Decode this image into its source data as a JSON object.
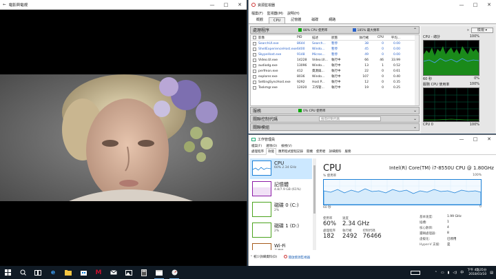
{
  "movie": {
    "title": "電影與電視",
    "controls": {
      "minimize": "—",
      "maximize": "□",
      "close": "✕",
      "back": "←"
    }
  },
  "resmon": {
    "title": "資源監視器",
    "menu": [
      "檔案(F)",
      "監視器(M)",
      "說明(H)"
    ],
    "tabs": [
      "概觀",
      "CPU",
      "記憶體",
      "磁碟",
      "網路"
    ],
    "active_tab": "CPU",
    "processes": {
      "label": "處理程序",
      "usage": "88% CPU 使用率",
      "freq": "185% 最大頻率",
      "columns": [
        "影像",
        "PID",
        "描述",
        "狀態",
        "執行緒",
        "CPU",
        "平均..."
      ],
      "rows": [
        {
          "img": "SearchUI.exe",
          "pid": "8644",
          "desc": "Search...",
          "state": "暫停",
          "th": "38",
          "cpu": "0",
          "avg": "0.00",
          "blue": true
        },
        {
          "img": "ShellExperienceHost.exe",
          "pid": "6400",
          "desc": "Windo...",
          "state": "暫停",
          "th": "45",
          "cpu": "0",
          "avg": "0.00",
          "blue": true
        },
        {
          "img": "SkypeHost.exe",
          "pid": "9148",
          "desc": "Micros...",
          "state": "暫停",
          "th": "49",
          "cpu": "0",
          "avg": "0.00",
          "blue": true
        },
        {
          "img": "Video.UI.exe",
          "pid": "14228",
          "desc": "Video.UI...",
          "state": "執行中",
          "th": "66",
          "cpu": "46",
          "avg": "33.99",
          "blue": false
        },
        {
          "img": "audiodg.exe",
          "pid": "13096",
          "desc": "Windo...",
          "state": "執行中",
          "th": "13",
          "cpu": "1",
          "avg": "0.52",
          "blue": false
        },
        {
          "img": "perfmon.exe",
          "pid": "412",
          "desc": "資源與...",
          "state": "執行中",
          "th": "22",
          "cpu": "0",
          "avg": "0.61",
          "blue": false
        },
        {
          "img": "explorer.exe",
          "pid": "8036",
          "desc": "Windo...",
          "state": "執行中",
          "th": "107",
          "cpu": "0",
          "avg": "0.40",
          "blue": false
        },
        {
          "img": "SettingSyncHost.exe",
          "pid": "9292",
          "desc": "Host P...",
          "state": "執行中",
          "th": "12",
          "cpu": "0",
          "avg": "0.35",
          "blue": false
        },
        {
          "img": "Taskmgr.exe",
          "pid": "12020",
          "desc": "工作管...",
          "state": "執行中",
          "th": "19",
          "cpu": "0",
          "avg": "0.25",
          "blue": false
        }
      ]
    },
    "services": {
      "label": "服務",
      "usage": "0% CPU 使用率"
    },
    "handles": {
      "label": "關聯控制代碼",
      "search_placeholder": "搜尋控制代碼"
    },
    "modules": {
      "label": "關聯模組"
    },
    "right": {
      "view_label": "檢視",
      "graph1_title": "CPU - 總計",
      "graph1_value": "100%",
      "graph1_footer_left": "60 秒",
      "graph1_footer_right": "0%",
      "graph2_title": "服務 CPU 使用率",
      "graph2_value": "100%",
      "graph2_footer_left": "CPU 0",
      "graph2_footer_right": "100%"
    }
  },
  "taskmgr": {
    "title": "工作管理員",
    "menu": [
      "檔案(F)",
      "選項(O)",
      "檢視(V)"
    ],
    "tabs": [
      "處理程序",
      "效能",
      "應用程式歷程記錄",
      "開機",
      "使用者",
      "詳細資料",
      "服務"
    ],
    "active_tab": "效能",
    "side_items": [
      {
        "name": "CPU",
        "sub": "60% 2.34 GHz",
        "color": "#1a7fd6"
      },
      {
        "name": "記憶體",
        "sub": "4.8/7.9 GB (61%)",
        "color": "#8b1aa6"
      },
      {
        "name": "磁碟 0 (C:)",
        "sub": "2%",
        "color": "#4aa31c"
      },
      {
        "name": "磁碟 1 (D:)",
        "sub": "2%",
        "color": "#4aa31c"
      },
      {
        "name": "Wi-Fi",
        "sub": "未連線",
        "color": "#a55a1a"
      }
    ],
    "main": {
      "title": "CPU",
      "model": "Intel(R) Core(TM) i7-8550U CPU @ 1.80GHz",
      "graph_label_left": "% 使用率",
      "graph_label_right": "100%",
      "graph_footer_left": "60 秒",
      "graph_footer_right": "0",
      "stats": [
        {
          "k": "使用率",
          "v": "60%"
        },
        {
          "k": "速度",
          "v": "2.34 GHz"
        }
      ],
      "stats2": [
        {
          "k": "處理程序",
          "v": "182"
        },
        {
          "k": "執行緒",
          "v": "2492"
        },
        {
          "k": "控制代碼",
          "v": "76466"
        }
      ],
      "info": [
        [
          "基本速度:",
          "1.99 GHz"
        ],
        [
          "插槽:",
          "1"
        ],
        [
          "核心數目:",
          "4"
        ],
        [
          "邏輯處理器:",
          "8"
        ],
        [
          "虛擬化:",
          "已停用"
        ],
        [
          "Hyper-V 支援:",
          "是"
        ]
      ]
    },
    "footer": {
      "fewer": "較少詳細資料(D)",
      "open_resmon": "開啟資源監視器"
    }
  },
  "taskbar": {
    "clock_time": "下午 4點35分",
    "clock_date": "2018/03/10",
    "tray_lang": "中",
    "icons": [
      "windows-start-icon",
      "search-icon",
      "task-view-icon",
      "edge-icon",
      "file-explorer-icon",
      "store-icon",
      "mcafee-icon",
      "mail-icon",
      "photos-icon",
      "calculator-icon",
      "movies-icon",
      "resmon-icon"
    ]
  }
}
